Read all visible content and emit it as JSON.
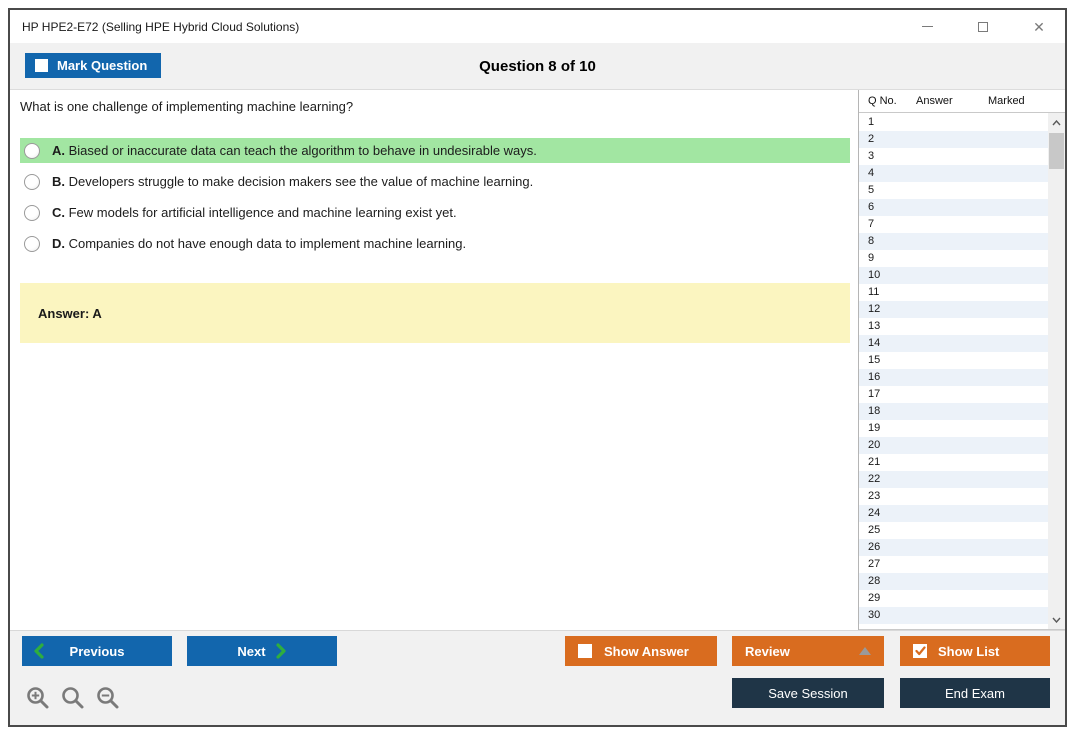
{
  "window": {
    "title": "HP HPE2-E72 (Selling HPE Hybrid Cloud Solutions)",
    "close_glyph": "✕"
  },
  "header": {
    "mark_question_label": "Mark Question",
    "question_counter": "Question 8 of 10"
  },
  "question": {
    "text": "What is one challenge of implementing machine learning?",
    "options": [
      {
        "letter": "A.",
        "text": "Biased or inaccurate data can teach the algorithm to behave in undesirable ways.",
        "highlighted": true
      },
      {
        "letter": "B.",
        "text": "Developers struggle to make decision makers see the value of machine learning.",
        "highlighted": false
      },
      {
        "letter": "C.",
        "text": "Few models for artificial intelligence and machine learning exist yet.",
        "highlighted": false
      },
      {
        "letter": "D.",
        "text": "Companies do not have enough data to implement machine learning.",
        "highlighted": false
      }
    ],
    "answer_label": "Answer: A"
  },
  "sidebar": {
    "columns": [
      "Q No.",
      "Answer",
      "Marked"
    ],
    "rows": [
      1,
      2,
      3,
      4,
      5,
      6,
      7,
      8,
      9,
      10,
      11,
      12,
      13,
      14,
      15,
      16,
      17,
      18,
      19,
      20,
      21,
      22,
      23,
      24,
      25,
      26,
      27,
      28,
      29,
      30
    ]
  },
  "footer": {
    "previous_label": "Previous",
    "next_label": "Next",
    "show_answer_label": "Show Answer",
    "review_label": "Review",
    "show_list_label": "Show List",
    "save_session_label": "Save Session",
    "end_exam_label": "End Exam"
  },
  "colors": {
    "blue": "#1266ad",
    "orange": "#d96c1f",
    "navy": "#1f3547",
    "green_highlight": "#a2e6a2",
    "answer_yellow": "#fbf5c0",
    "chevron_green": "#2fae3e",
    "row_alt": "#ecf2f9"
  }
}
